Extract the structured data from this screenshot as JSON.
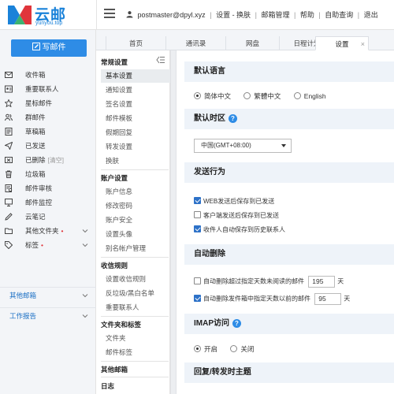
{
  "brand": {
    "name": "云邮",
    "subtitle": "yunyou.top",
    "colors": {
      "accent": "#2e8ce6",
      "logo_blue": "#1a82d9",
      "logo_red": "#e0353b",
      "logo_green": "#3cb371"
    }
  },
  "header": {
    "user": "postmaster@dpyl.xyz",
    "links": [
      "设置 - 换肤",
      "邮箱管理",
      "帮助",
      "自助查询",
      "退出"
    ]
  },
  "sidebar": {
    "compose_label": "写邮件",
    "items": [
      {
        "label": "收件箱",
        "icon": "inbox-icon"
      },
      {
        "label": "重要联系人",
        "icon": "contact-card-icon"
      },
      {
        "label": "星标邮件",
        "icon": "star-icon"
      },
      {
        "label": "群邮件",
        "icon": "group-icon"
      },
      {
        "label": "草稿箱",
        "icon": "draft-icon"
      },
      {
        "label": "已发送",
        "icon": "sent-icon"
      },
      {
        "label": "已删除",
        "hint": "[清空]",
        "icon": "deleted-icon"
      },
      {
        "label": "垃圾箱",
        "icon": "trash-icon"
      },
      {
        "label": "邮件审核",
        "icon": "review-icon"
      },
      {
        "label": "邮件监控",
        "icon": "monitor-icon"
      },
      {
        "label": "云笔记",
        "icon": "note-icon"
      },
      {
        "label": "其他文件夹",
        "dot": "•",
        "icon": "folder-icon"
      },
      {
        "label": "标签",
        "dot": "•",
        "icon": "tag-icon"
      }
    ],
    "sections": [
      "其他邮箱",
      "工作报告"
    ]
  },
  "tabs": [
    {
      "label": "首页"
    },
    {
      "label": "通讯录"
    },
    {
      "label": "网盘"
    },
    {
      "label": "日程计划"
    },
    {
      "label": "设置",
      "active": true,
      "close": "×"
    }
  ],
  "settings_nav": {
    "groups": [
      {
        "title": "常规设置",
        "items": [
          "基本设置",
          "通知设置",
          "签名设置",
          "邮件模板",
          "假期回复",
          "转发设置",
          "换肤"
        ]
      },
      {
        "title": "账户设置",
        "items": [
          "账户信息",
          "修改密码",
          "账户安全",
          "设置头像",
          "别名帐户管理"
        ]
      },
      {
        "title": "收信规则",
        "items": [
          "设置收信规则",
          "反垃圾/黑白名单",
          "重要联系人"
        ]
      },
      {
        "title": "文件夹和标签",
        "items": [
          "文件夹",
          "邮件标签"
        ]
      },
      {
        "title": "其他邮箱",
        "items": []
      },
      {
        "title": "日志",
        "items": []
      }
    ],
    "active_item": "基本设置"
  },
  "content": {
    "language": {
      "title": "默认语言",
      "options": [
        "简体中文",
        "繁體中文",
        "English"
      ],
      "selected": "简体中文"
    },
    "timezone": {
      "title": "默认时区",
      "value": "中国(GMT+08:00)"
    },
    "send_behavior": {
      "title": "发送行为",
      "options": [
        {
          "label": "WEB发送后保存到已发送",
          "checked": true
        },
        {
          "label": "客户端发送后保存到已发送",
          "checked": false
        },
        {
          "label": "收件人自动保存到历史联系人",
          "checked": true
        }
      ]
    },
    "auto_delete": {
      "title": "自动删除",
      "rules": [
        {
          "prefix": "自动删除超过指定天数未阅读的邮件",
          "value": "195",
          "suffix": "天",
          "checked": false
        },
        {
          "prefix": "自动删除发件箱中指定天数以前的邮件",
          "value": "95",
          "suffix": "天",
          "checked": true
        }
      ]
    },
    "imap": {
      "title": "IMAP访问",
      "options": [
        "开启",
        "关闭"
      ],
      "selected": "开启"
    },
    "reply_forward": {
      "title": "回复/转发时主题"
    }
  }
}
